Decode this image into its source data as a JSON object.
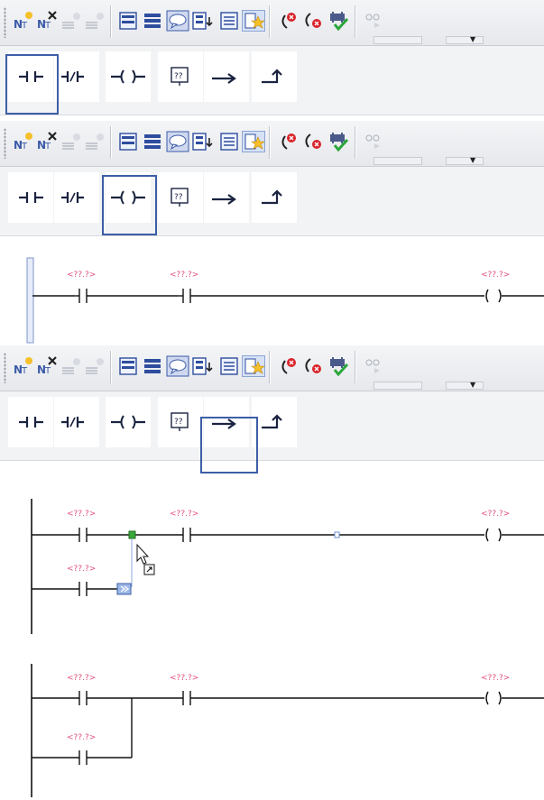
{
  "toolbar_buttons": [
    {
      "name": "insert-network-icon",
      "title": "Insert network"
    },
    {
      "name": "delete-network-icon",
      "title": "Delete network"
    },
    {
      "name": "insert-row-icon",
      "title": "Insert row"
    },
    {
      "name": "append-row-icon",
      "title": "Append row"
    },
    {
      "name": "open-all-networks-icon",
      "title": "Open all networks"
    },
    {
      "name": "close-all-networks-icon",
      "title": "Close all networks"
    },
    {
      "name": "network-comments-icon",
      "title": "Network comments"
    },
    {
      "name": "absolute-operands-icon",
      "title": "Absolute operands"
    },
    {
      "name": "favorites-list-icon",
      "title": "Favorites"
    },
    {
      "name": "favorites-star-icon",
      "title": "Favorites star"
    },
    {
      "name": "goto-previous-error-icon",
      "title": "Go to previous error"
    },
    {
      "name": "goto-next-error-icon",
      "title": "Go to next error"
    },
    {
      "name": "update-calls-icon",
      "title": "Update calls"
    },
    {
      "name": "monitoring-icon",
      "title": "Monitoring"
    }
  ],
  "ladder_palette": [
    {
      "name": "normally-open-contact-icon",
      "title": "Normally open contact"
    },
    {
      "name": "normally-closed-contact-icon",
      "title": "Normally closed contact"
    },
    {
      "name": "output-coil-icon",
      "title": "Output coil"
    },
    {
      "name": "empty-box-icon",
      "title": "Empty box",
      "glyph": "??"
    },
    {
      "name": "open-branch-icon",
      "title": "Open branch"
    },
    {
      "name": "close-branch-icon",
      "title": "Close branch"
    }
  ],
  "operand_placeholder": "<??.?>",
  "empty_box_glyph": "??",
  "colors": {
    "selection_frame": "#3d5ea6",
    "placeholder": "#e0507a",
    "coil_line": "#1a2340"
  }
}
